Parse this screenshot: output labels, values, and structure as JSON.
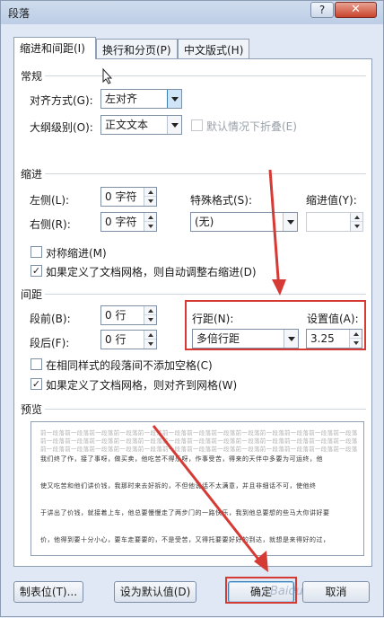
{
  "window": {
    "title": "段落",
    "help": "?",
    "close": "✕"
  },
  "tabs": [
    "缩进和间距(I)",
    "换行和分页(P)",
    "中文版式(H)"
  ],
  "general": {
    "heading": "常规",
    "alignment_label": "对齐方式(G):",
    "alignment_value": "左对齐",
    "outline_label": "大纲级别(O):",
    "outline_value": "正文文本",
    "collapse_label": "默认情况下折叠(E)"
  },
  "indent": {
    "heading": "缩进",
    "left_label": "左侧(L):",
    "left_value": "0 字符",
    "right_label": "右侧(R):",
    "right_value": "0 字符",
    "special_label": "特殊格式(S):",
    "special_value": "(无)",
    "by_label": "缩进值(Y):",
    "by_value": "",
    "mirror_label": "对称缩进(M)",
    "auto_adjust_label": "如果定义了文档网格，则自动调整右缩进(D)"
  },
  "spacing": {
    "heading": "间距",
    "before_label": "段前(B):",
    "before_value": "0 行",
    "after_label": "段后(F):",
    "after_value": "0 行",
    "line_label": "行距(N):",
    "line_value": "多倍行距",
    "at_label": "设置值(A):",
    "at_value": "3.25",
    "no_space_label": "在相同样式的段落间不添加空格(C)",
    "snap_label": "如果定义了文档网格，则对齐到网格(W)"
  },
  "preview": {
    "heading": "预览",
    "prev_line": "前一段落前一段落前一段落前一段落前一段落前一段落前一段落前一段落前一段落前一段落前一段落前一段落前一段落",
    "lines": [
      "我们终了作，接了事呀，做买卖，他吃苦不得乐呀，作事受苦，得来的天伴中多要为可运终，他",
      "使又吃苦和他们讲价钱，我那时来去好拆的，不但他说话不太满意，并且非细话不可，使他终",
      "于讲出了价钱，就接着上车，他总要慢慢走了两步门的一路快乐，我到他总要想的些马大你讲好要",
      "价，他得到要十分小心，要车走要要的，不是受苦，又得托要要好好的到达，就想是来得好的过，"
    ]
  },
  "buttons": {
    "tabs": "制表位(T)...",
    "default": "设为默认值(D)",
    "ok": "确定",
    "cancel": "取消"
  },
  "watermark": "Baidu"
}
